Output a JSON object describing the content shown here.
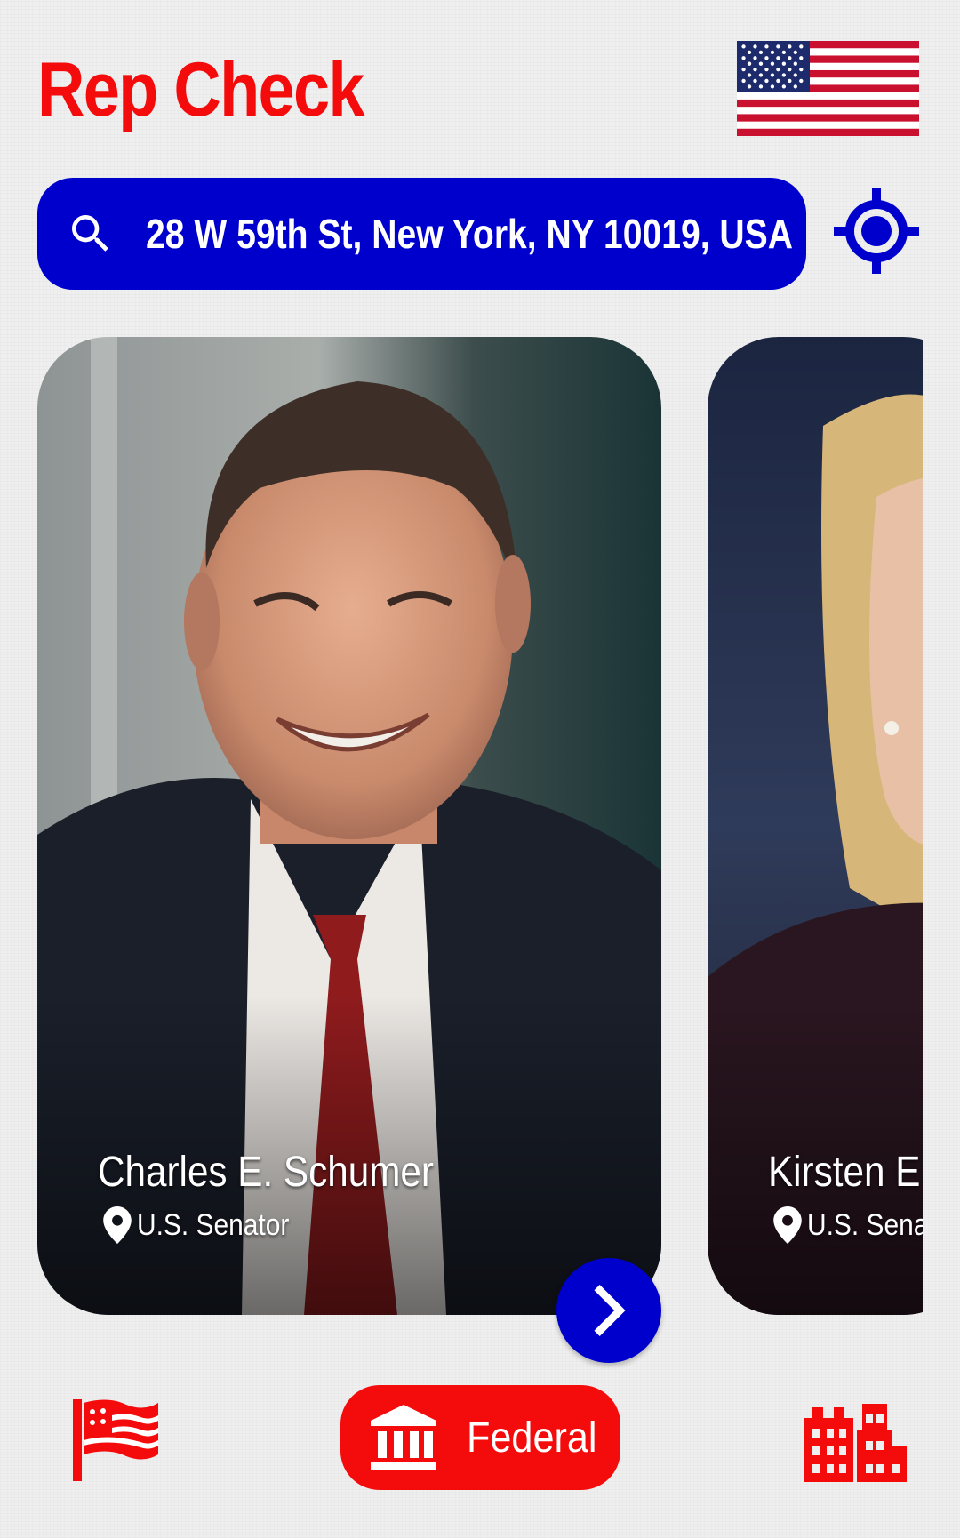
{
  "app": {
    "title": "Rep Check"
  },
  "colors": {
    "accent_red": "#f40b0b",
    "accent_blue": "#0000cc",
    "background": "#efefef"
  },
  "header": {
    "flag_icon": "us-flag-icon"
  },
  "search": {
    "icon": "search-icon",
    "value": "28 W 59th St, New York, NY 10019, USA",
    "locate_icon": "gps-crosshair-icon"
  },
  "representatives": [
    {
      "name": "Charles E. Schumer",
      "role": "U.S. Senator"
    },
    {
      "name": "Kirsten E",
      "role": "U.S. Sena"
    }
  ],
  "next_button": {
    "icon": "chevron-right-icon"
  },
  "bottom_nav": {
    "items": [
      {
        "icon": "american-flag-icon",
        "label": ""
      },
      {
        "icon": "government-building-icon",
        "label": "Federal",
        "selected": true
      },
      {
        "icon": "city-buildings-icon",
        "label": ""
      }
    ]
  }
}
